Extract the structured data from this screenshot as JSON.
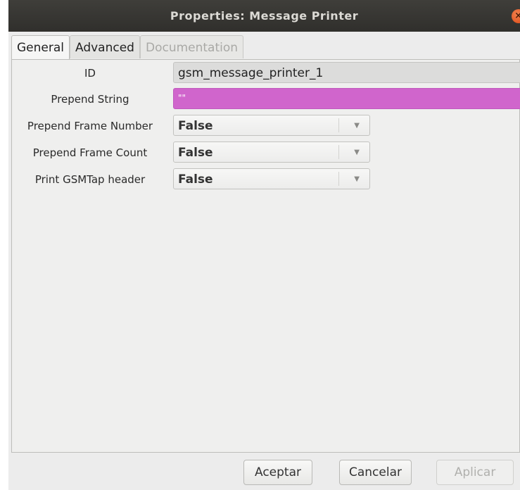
{
  "window": {
    "title": "Properties: Message Printer",
    "close_icon": "×"
  },
  "tabs": [
    {
      "label": "General",
      "state": "active"
    },
    {
      "label": "Advanced",
      "state": "normal"
    },
    {
      "label": "Documentation",
      "state": "disabled"
    }
  ],
  "fields": {
    "id": {
      "label": "ID",
      "value": "gsm_message_printer_1"
    },
    "prepend_string": {
      "label": "Prepend String",
      "value": "\"\""
    },
    "prepend_frame_number": {
      "label": "Prepend Frame Number",
      "value": "False"
    },
    "prepend_frame_count": {
      "label": "Prepend Frame Count",
      "value": "False"
    },
    "print_gsmtap_header": {
      "label": "Print GSMTap header",
      "value": "False"
    }
  },
  "buttons": {
    "ok": "Aceptar",
    "cancel": "Cancelar",
    "apply": "Aplicar"
  },
  "colors": {
    "titlebar": "#302f2c",
    "close_button": "#dd4814",
    "prepend_string_field": "#d065cc"
  }
}
